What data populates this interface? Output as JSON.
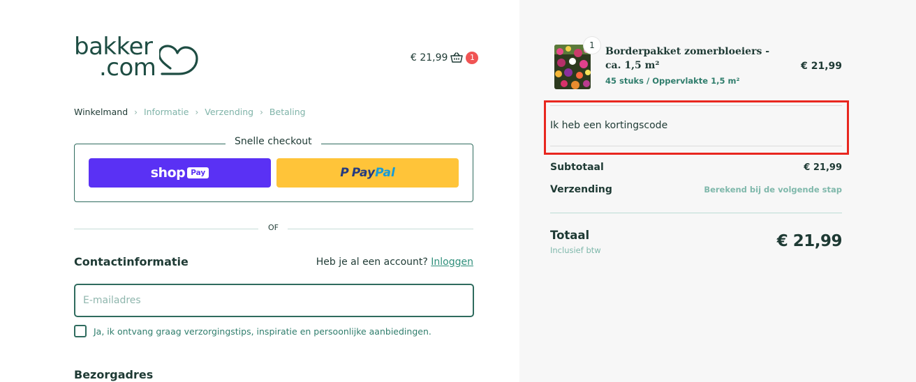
{
  "brand": {
    "logo_line1": "bakker",
    "logo_line2": ".com"
  },
  "header": {
    "cart_price": "€ 21,99",
    "cart_count": "1"
  },
  "breadcrumb": {
    "items": [
      {
        "label": "Winkelmand",
        "active": true
      },
      {
        "label": "Informatie",
        "active": false
      },
      {
        "label": "Verzending",
        "active": false
      },
      {
        "label": "Betaling",
        "active": false
      }
    ]
  },
  "express_checkout": {
    "legend": "Snelle checkout",
    "shop_word": "shop",
    "shop_pay": "Pay",
    "paypal_part1": "Pay",
    "paypal_part2": "Pal"
  },
  "divider": {
    "or_label": "OF"
  },
  "contact": {
    "title": "Contactinformatie",
    "account_prompt": "Heb je al een account?",
    "login_label": "Inloggen",
    "email_placeholder": "E-mailadres",
    "email_value": "",
    "newsletter_label": "Ja, ik ontvang graag verzorgingstips, inspiratie en persoonlijke aanbiedingen."
  },
  "shipping": {
    "title": "Bezorgadres"
  },
  "order_summary": {
    "product": {
      "name": "Borderpakket zomerbloeiers - ca. 1,5 m²",
      "variant": "45 stuks / Oppervlakte 1,5 m²",
      "price": "€ 21,99",
      "quantity": "1"
    },
    "discount_label": "Ik heb een kortingscode",
    "subtotal_label": "Subtotaal",
    "subtotal_value": "€ 21,99",
    "shipping_label": "Verzending",
    "shipping_value": "Berekend bij de volgende stap",
    "total_label": "Totaal",
    "total_sub": "Inclusief btw",
    "total_value": "€ 21,99"
  },
  "colors": {
    "brand_green": "#1e4d43",
    "accent_teal": "#2f8f7b",
    "shoppay_purple": "#5a31f4",
    "paypal_yellow": "#ffc439",
    "badge_red": "#f05454",
    "highlight_red": "#e8271f"
  }
}
